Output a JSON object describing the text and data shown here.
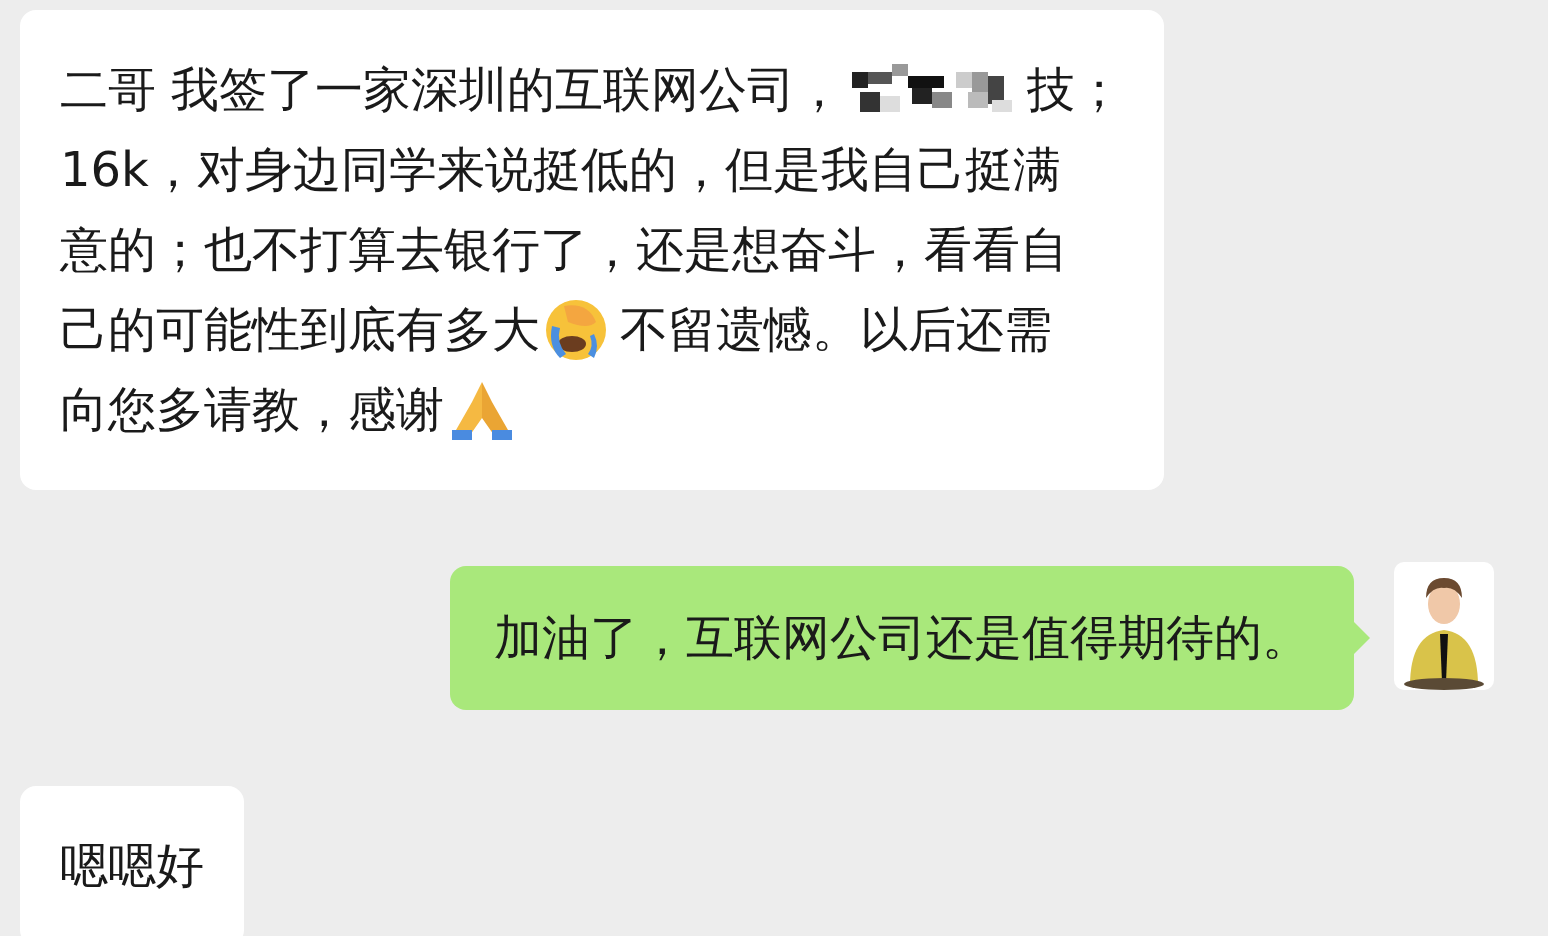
{
  "messages": [
    {
      "kind": "incoming",
      "lines": [
        [
          {
            "kind": "text",
            "text": "二哥 我签了一家深圳的互联网公司，"
          },
          {
            "kind": "mosaic"
          },
          {
            "kind": "text",
            "text": "技；"
          }
        ],
        [
          {
            "kind": "text",
            "text": "16k，对身边同学来说挺低的，但是我自己挺满"
          }
        ],
        [
          {
            "kind": "text",
            "text": "意的；也不打算去银行了，还是想奋斗，看看自"
          }
        ],
        [
          {
            "kind": "text",
            "text": "己的可能性到底有多大"
          },
          {
            "kind": "facepalm"
          },
          {
            "kind": "text",
            "text": "不留遗憾。以后还需"
          }
        ],
        [
          {
            "kind": "text",
            "text": "向您多请教，感谢"
          },
          {
            "kind": "pray"
          }
        ]
      ]
    },
    {
      "kind": "outgoing",
      "lines": [
        [
          {
            "kind": "text",
            "text": "加油了，互联网公司还是值得期待的。"
          }
        ]
      ]
    },
    {
      "kind": "incoming",
      "lines": [
        [
          {
            "kind": "text",
            "text": "嗯嗯好"
          }
        ]
      ]
    }
  ]
}
